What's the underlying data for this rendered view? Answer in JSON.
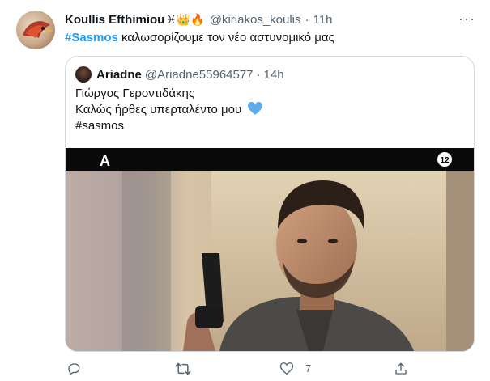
{
  "tweet": {
    "author_name": "Koullis Efthimiou",
    "author_emojis": "♓👑🔥",
    "handle": "@kiriakos_koulis",
    "separator": "·",
    "time": "11h",
    "more": "···",
    "hashtag": "#Sasmos",
    "text": " καλωσορίζουμε τον νέο αστυνομικό μας"
  },
  "quote": {
    "author_name": "Ariadne",
    "handle": "@Ariadne55964577",
    "separator": "·",
    "time": "14h",
    "line1": "Γιώργος Γεροντιδάκης",
    "line2": "Καλώς ήρθες υπερταλέντο μου",
    "line3": "#sasmos",
    "media": {
      "channel_logo": "A",
      "rating_badge": "12"
    }
  },
  "actions": {
    "reply_icon": "reply-icon",
    "retweet_icon": "retweet-icon",
    "like_icon": "heart-icon",
    "like_count": "7",
    "share_icon": "share-icon"
  },
  "colors": {
    "accent": "#1d9bf0",
    "secondary_text": "#536471",
    "border": "#cfd9de",
    "heart_emoji": "#5dadec"
  }
}
